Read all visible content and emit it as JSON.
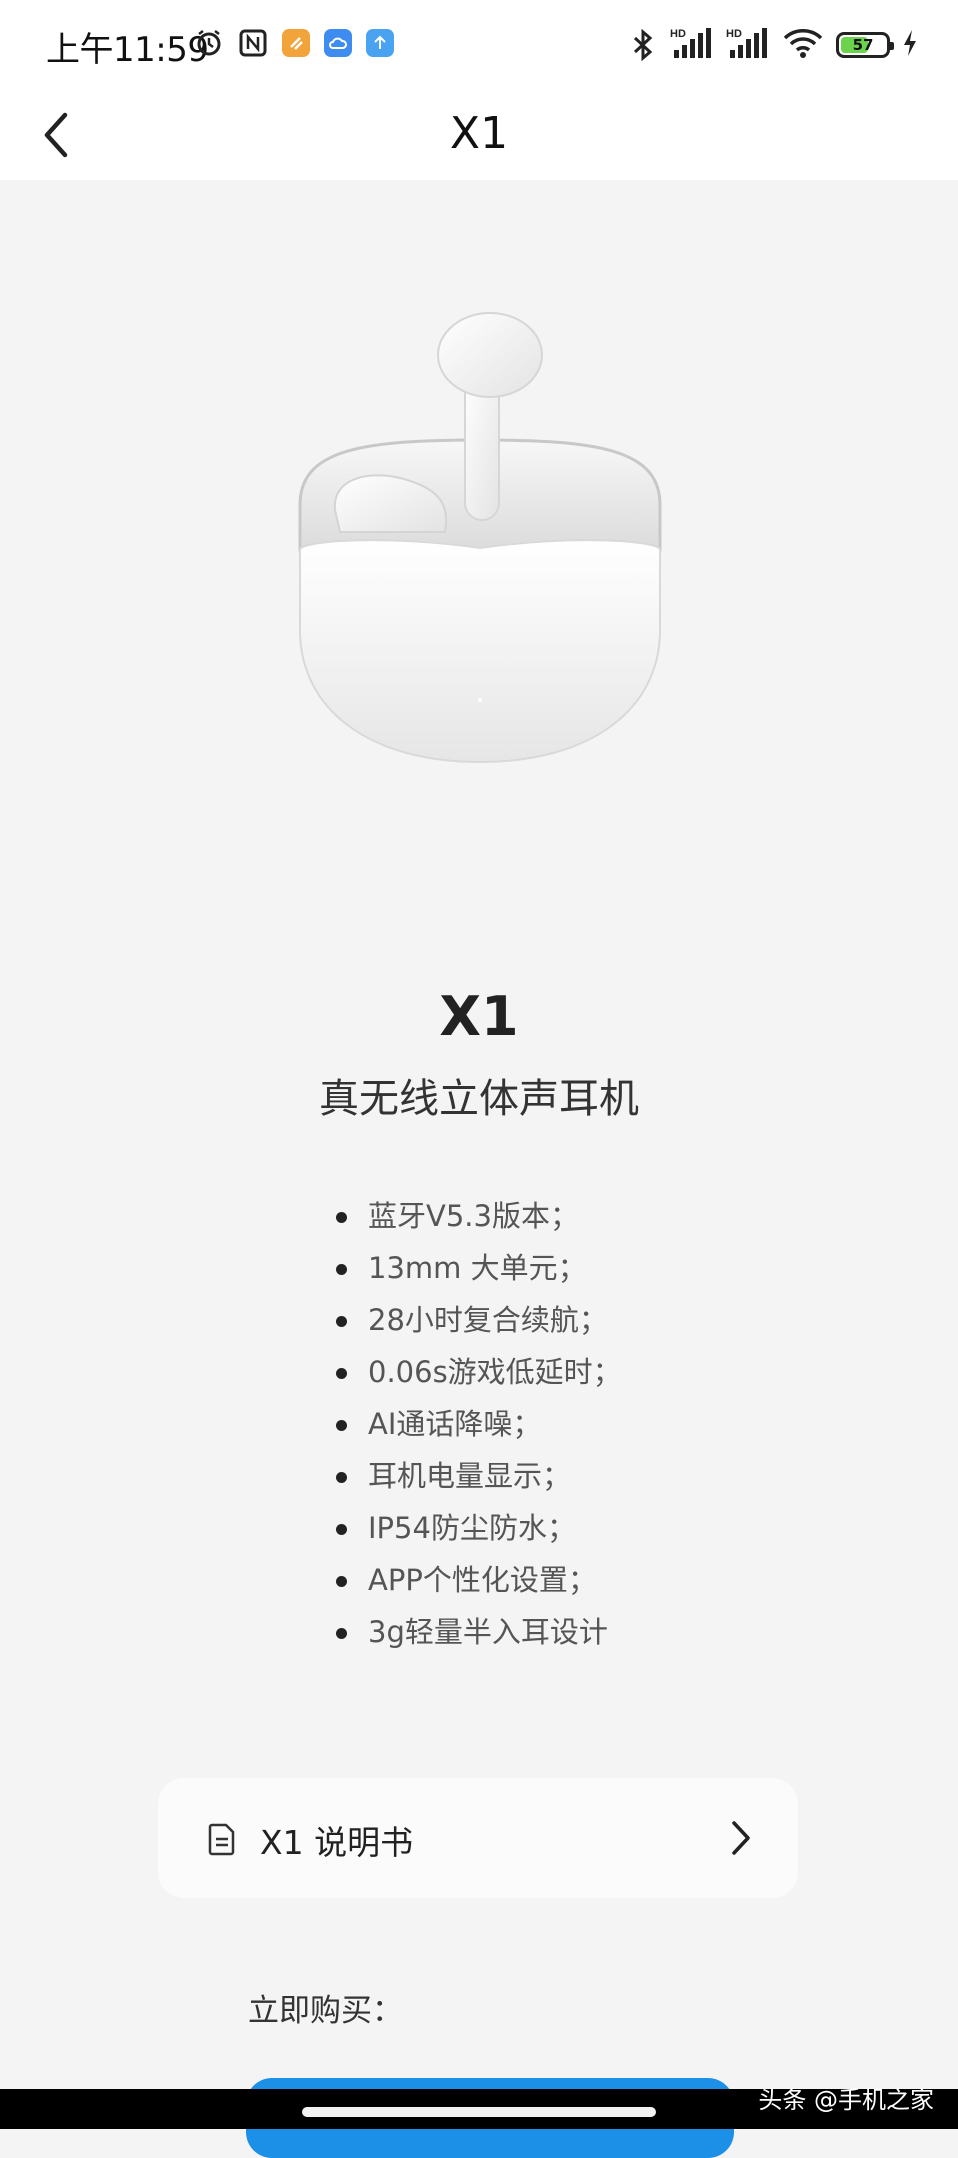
{
  "status_bar": {
    "time": "上午11:59",
    "battery_level": "57",
    "battery_fraction": 0.57,
    "left_icons": [
      "alarm-icon",
      "nfc-icon",
      "app-badge-orange",
      "app-badge-cloud",
      "app-badge-upload"
    ],
    "right_icons": [
      "bluetooth-icon",
      "signal-hd-1-icon",
      "signal-hd-2-icon",
      "wifi-icon",
      "battery-icon",
      "charging-icon"
    ]
  },
  "nav": {
    "title": "X1",
    "back_icon": "chevron-left-icon"
  },
  "product": {
    "name": "X1",
    "subtitle": "真无线立体声耳机",
    "features": [
      "蓝牙V5.3版本；",
      "13mm 大单元；",
      "28小时复合续航；",
      "0.06s游戏低延时；",
      "AI通话降噪；",
      "耳机电量显示；",
      "IP54防尘防水；",
      "APP个性化设置；",
      "3g轻量半入耳设计"
    ]
  },
  "manual": {
    "label": "X1 说明书",
    "icon": "document-icon",
    "chevron": "chevron-right-icon"
  },
  "buy": {
    "label": "立即购买："
  },
  "watermark": "头条 @手机之家",
  "colors": {
    "background": "#f4f4f4",
    "card": "#fbfbfb",
    "buy_button": "#1c8fe6",
    "battery_fill": "#6cd34c"
  }
}
